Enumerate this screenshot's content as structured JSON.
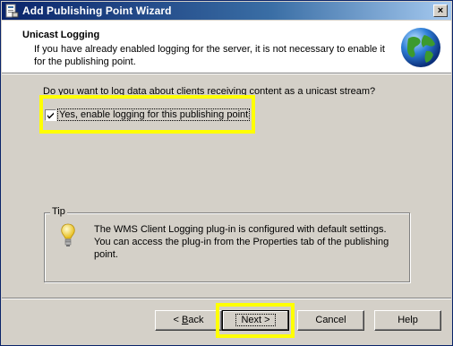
{
  "window": {
    "title": "Add Publishing Point Wizard",
    "close_label": "×"
  },
  "header": {
    "title": "Unicast Logging",
    "description": "If you have already enabled logging for the server, it is not necessary to enable it for the publishing point."
  },
  "body": {
    "question": "Do you want to log data about clients receiving content as a unicast stream?",
    "checkbox": {
      "label": "Yes, enable logging for this publishing point",
      "checked": true
    }
  },
  "tip": {
    "legend": "Tip",
    "text": "The WMS Client Logging plug-in is configured with default settings. You can access the plug-in from the Properties tab of the publishing point."
  },
  "buttons": {
    "back_rest": "Back",
    "back_prefix": "< ",
    "next": "Next >",
    "cancel": "Cancel",
    "help": "Help"
  },
  "colors": {
    "highlight": "#ffff00",
    "title_bar": "#0a246a",
    "face": "#d4d0c8"
  },
  "icons": {
    "app": "wizard-app-icon",
    "globe": "globe-icon",
    "tip": "lightbulb-icon"
  }
}
